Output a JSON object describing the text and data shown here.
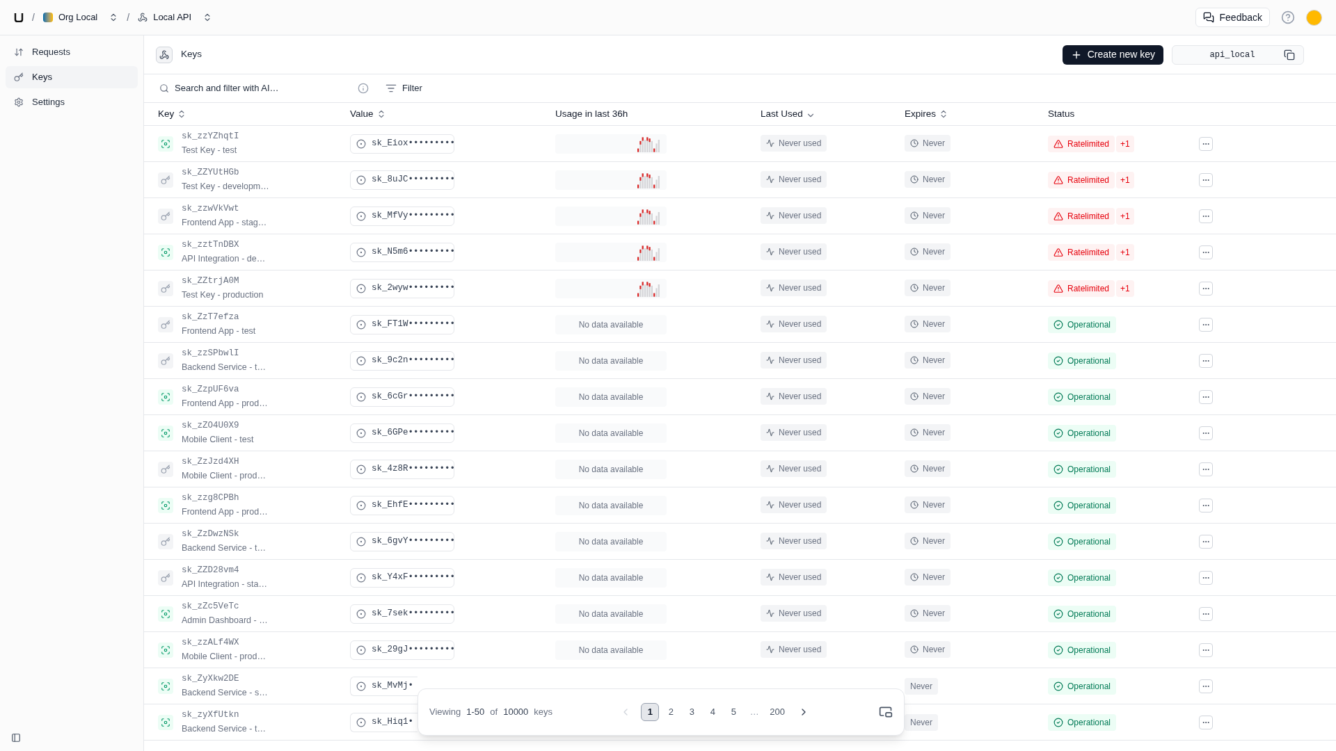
{
  "breadcrumb": [
    {
      "separator": "/",
      "label": "Org Local",
      "kind": "org"
    },
    {
      "separator": "/",
      "label": "Local API",
      "kind": "api"
    }
  ],
  "topbar": {
    "feedback": "Feedback"
  },
  "sidebar": {
    "items": [
      {
        "label": "Requests",
        "kind": "requests",
        "selected": false
      },
      {
        "label": "Keys",
        "kind": "keys",
        "selected": true
      },
      {
        "label": "Settings",
        "kind": "settings",
        "selected": false
      }
    ]
  },
  "header": {
    "title": "Keys",
    "create_button": "Create new key",
    "api_id": "api_local"
  },
  "search": {
    "placeholder": "Search and filter with AI…",
    "filter": "Filter"
  },
  "table": {
    "columns": [
      {
        "label": "Key",
        "kind": "sortable"
      },
      {
        "label": "Value",
        "kind": "sortable"
      },
      {
        "label": "Usage in last 36h",
        "kind": "plain"
      },
      {
        "label": "Last Used",
        "kind": "sorted"
      },
      {
        "label": "Expires",
        "kind": "sortable"
      },
      {
        "label": "Status",
        "kind": "plain"
      }
    ],
    "rows": [
      {
        "key": "sk_zzYZhqtI",
        "name": "Test Key - test",
        "kind": "scan",
        "value": "sk_Eiox•••••••••",
        "usage": {
          "kind": "chart"
        },
        "last_used": "Never used",
        "expires": "Never",
        "status": {
          "kind": "ratelimited",
          "label": "Ratelimited",
          "extra": "+1"
        }
      },
      {
        "key": "sk_ZZYUtHGb",
        "name": "Test Key - developm…",
        "kind": "key",
        "value": "sk_8uJC•••••••••",
        "usage": {
          "kind": "chart"
        },
        "last_used": "Never used",
        "expires": "Never",
        "status": {
          "kind": "ratelimited",
          "label": "Ratelimited",
          "extra": "+1"
        }
      },
      {
        "key": "sk_zzwVkVwt",
        "name": "Frontend App - stag…",
        "kind": "key",
        "value": "sk_MfVy•••••••••",
        "usage": {
          "kind": "chart"
        },
        "last_used": "Never used",
        "expires": "Never",
        "status": {
          "kind": "ratelimited",
          "label": "Ratelimited",
          "extra": "+1"
        }
      },
      {
        "key": "sk_zztTnDBX",
        "name": "API Integration - de…",
        "kind": "scan",
        "value": "sk_N5m6•••••••••",
        "usage": {
          "kind": "chart"
        },
        "last_used": "Never used",
        "expires": "Never",
        "status": {
          "kind": "ratelimited",
          "label": "Ratelimited",
          "extra": "+1"
        }
      },
      {
        "key": "sk_ZZtrjA0M",
        "name": "Test Key - production",
        "kind": "key",
        "value": "sk_2wyw•••••••••",
        "usage": {
          "kind": "chart"
        },
        "last_used": "Never used",
        "expires": "Never",
        "status": {
          "kind": "ratelimited",
          "label": "Ratelimited",
          "extra": "+1"
        }
      },
      {
        "key": "sk_ZzT7efza",
        "name": "Frontend App - test",
        "kind": "key",
        "value": "sk_FT1W•••••••••",
        "usage": {
          "kind": "empty",
          "label": "No data available"
        },
        "last_used": "Never used",
        "expires": "Never",
        "status": {
          "kind": "operational",
          "label": "Operational"
        }
      },
      {
        "key": "sk_zzSPbwlI",
        "name": "Backend Service - t…",
        "kind": "key",
        "value": "sk_9c2n•••••••••",
        "usage": {
          "kind": "empty",
          "label": "No data available"
        },
        "last_used": "Never used",
        "expires": "Never",
        "status": {
          "kind": "operational",
          "label": "Operational"
        }
      },
      {
        "key": "sk_ZzpUF6va",
        "name": "Frontend App - prod…",
        "kind": "scan",
        "value": "sk_6cGr•••••••••",
        "usage": {
          "kind": "empty",
          "label": "No data available"
        },
        "last_used": "Never used",
        "expires": "Never",
        "status": {
          "kind": "operational",
          "label": "Operational"
        }
      },
      {
        "key": "sk_zZO4U0X9",
        "name": "Mobile Client - test",
        "kind": "scan",
        "value": "sk_6GPe•••••••••",
        "usage": {
          "kind": "empty",
          "label": "No data available"
        },
        "last_used": "Never used",
        "expires": "Never",
        "status": {
          "kind": "operational",
          "label": "Operational"
        }
      },
      {
        "key": "sk_ZzJzd4XH",
        "name": "Mobile Client - prod…",
        "kind": "key",
        "value": "sk_4z8R•••••••••",
        "usage": {
          "kind": "empty",
          "label": "No data available"
        },
        "last_used": "Never used",
        "expires": "Never",
        "status": {
          "kind": "operational",
          "label": "Operational"
        }
      },
      {
        "key": "sk_zzg8CPBh",
        "name": "Frontend App - prod…",
        "kind": "scan",
        "value": "sk_EhfE•••••••••",
        "usage": {
          "kind": "empty",
          "label": "No data available"
        },
        "last_used": "Never used",
        "expires": "Never",
        "status": {
          "kind": "operational",
          "label": "Operational"
        }
      },
      {
        "key": "sk_ZzDwzNSk",
        "name": "Backend Service - t…",
        "kind": "key",
        "value": "sk_6gvY•••••••••",
        "usage": {
          "kind": "empty",
          "label": "No data available"
        },
        "last_used": "Never used",
        "expires": "Never",
        "status": {
          "kind": "operational",
          "label": "Operational"
        }
      },
      {
        "key": "sk_ZZD28vm4",
        "name": "API Integration - sta…",
        "kind": "key",
        "value": "sk_Y4xF•••••••••",
        "usage": {
          "kind": "empty",
          "label": "No data available"
        },
        "last_used": "Never used",
        "expires": "Never",
        "status": {
          "kind": "operational",
          "label": "Operational"
        }
      },
      {
        "key": "sk_zZc5VeTc",
        "name": "Admin Dashboard - …",
        "kind": "scan",
        "value": "sk_7sek•••••••••",
        "usage": {
          "kind": "empty",
          "label": "No data available"
        },
        "last_used": "Never used",
        "expires": "Never",
        "status": {
          "kind": "operational",
          "label": "Operational"
        }
      },
      {
        "key": "sk_zzALf4WX",
        "name": "Mobile Client - prod…",
        "kind": "scan",
        "value": "sk_29gJ•••••••••",
        "usage": {
          "kind": "empty",
          "label": "No data available"
        },
        "last_used": "Never used",
        "expires": "Never",
        "status": {
          "kind": "operational",
          "label": "Operational"
        }
      },
      {
        "key": "sk_ZyXkw2DE",
        "name": "Backend Service - s…",
        "kind": "scan",
        "value": "sk_MvMj•",
        "covered": true,
        "expires": "Never",
        "status": {
          "kind": "operational",
          "label": "Operational"
        }
      },
      {
        "key": "sk_zyXfUtkn",
        "name": "Backend Service - t…",
        "kind": "scan",
        "value": "sk_Hiq1•",
        "covered": true,
        "expires": "Never",
        "status": {
          "kind": "operational",
          "label": "Operational"
        }
      }
    ]
  },
  "pagination": {
    "viewing": "Viewing",
    "range": "1-50",
    "of": "of",
    "total": "10000",
    "unit": "keys",
    "pages": [
      {
        "label": "1",
        "selected": true
      },
      {
        "label": "2",
        "selected": false
      },
      {
        "label": "3",
        "selected": false
      },
      {
        "label": "4",
        "selected": false
      },
      {
        "label": "5",
        "selected": false
      },
      {
        "label": "…",
        "kind": "gap"
      },
      {
        "label": "200",
        "selected": false
      }
    ]
  }
}
